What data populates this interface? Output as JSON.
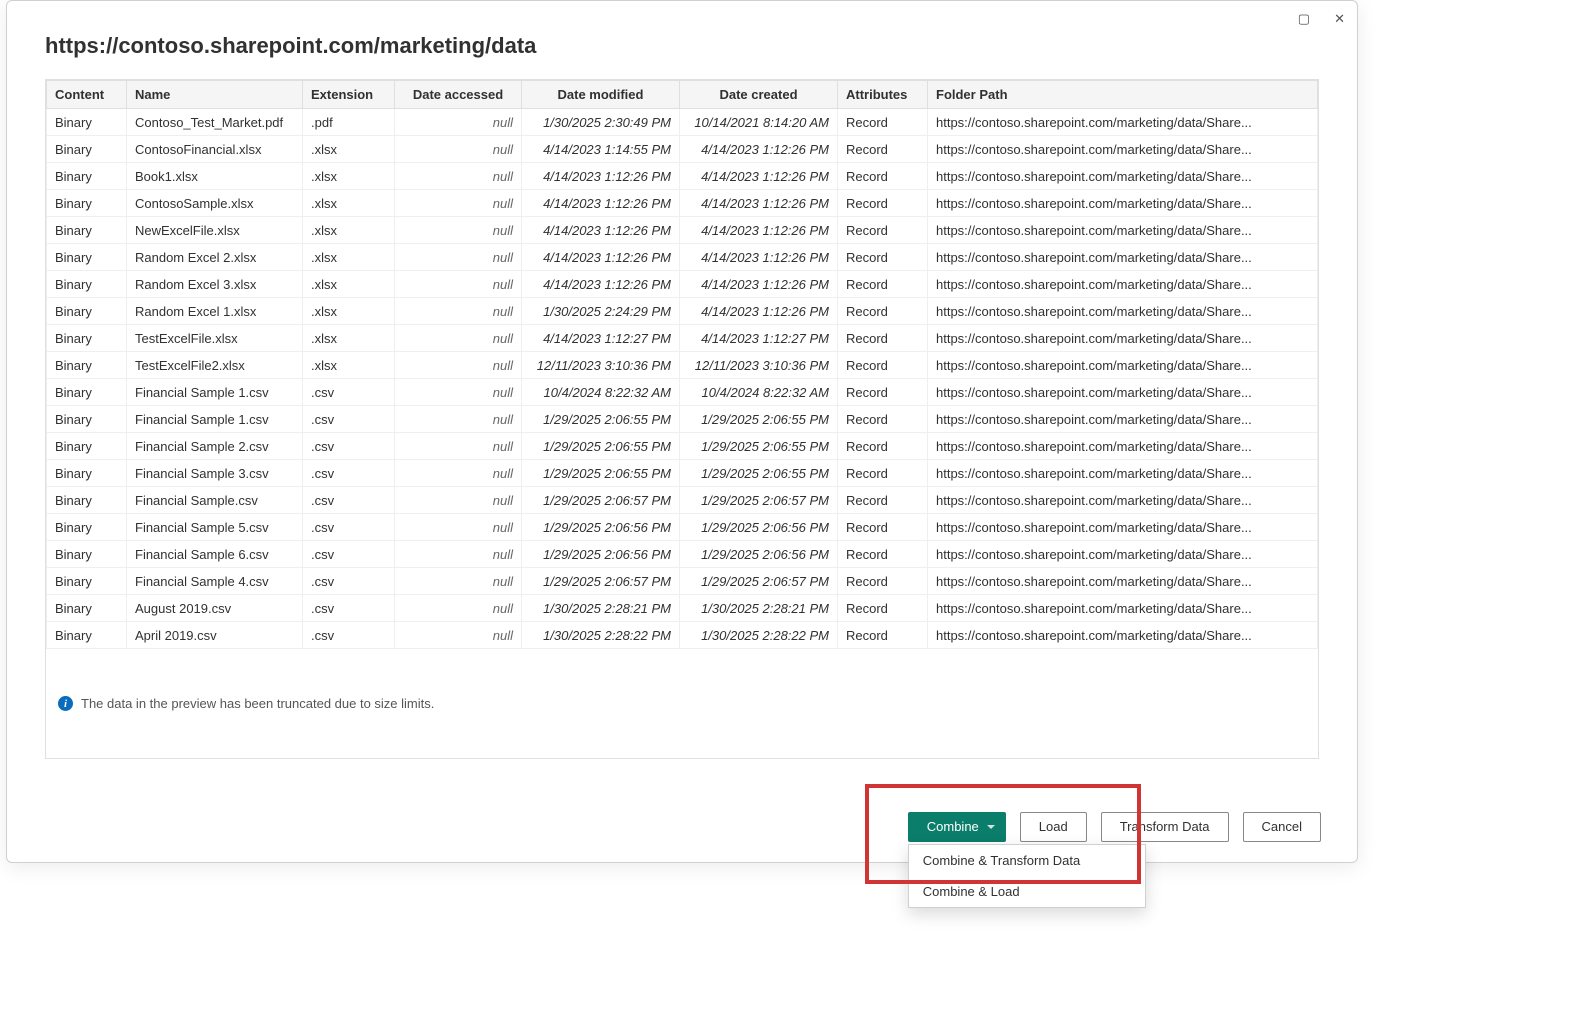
{
  "title": "https://contoso.sharepoint.com/marketing/data",
  "columns": [
    "Content",
    "Name",
    "Extension",
    "Date accessed",
    "Date modified",
    "Date created",
    "Attributes",
    "Folder Path"
  ],
  "null_label": "null",
  "rows": [
    {
      "content": "Binary",
      "name": "Contoso_Test_Market.pdf",
      "ext": ".pdf",
      "acc": "null",
      "mod": "1/30/2025 2:30:49 PM",
      "cre": "10/14/2021 8:14:20 AM",
      "attr": "Record",
      "path": "https://contoso.sharepoint.com/marketing/data/Share..."
    },
    {
      "content": "Binary",
      "name": "ContosoFinancial.xlsx",
      "ext": ".xlsx",
      "acc": "null",
      "mod": "4/14/2023 1:14:55 PM",
      "cre": "4/14/2023 1:12:26 PM",
      "attr": "Record",
      "path": "https://contoso.sharepoint.com/marketing/data/Share..."
    },
    {
      "content": "Binary",
      "name": "Book1.xlsx",
      "ext": ".xlsx",
      "acc": "null",
      "mod": "4/14/2023 1:12:26 PM",
      "cre": "4/14/2023 1:12:26 PM",
      "attr": "Record",
      "path": "https://contoso.sharepoint.com/marketing/data/Share..."
    },
    {
      "content": "Binary",
      "name": "ContosoSample.xlsx",
      "ext": ".xlsx",
      "acc": "null",
      "mod": "4/14/2023 1:12:26 PM",
      "cre": "4/14/2023 1:12:26 PM",
      "attr": "Record",
      "path": "https://contoso.sharepoint.com/marketing/data/Share..."
    },
    {
      "content": "Binary",
      "name": "NewExcelFile.xlsx",
      "ext": ".xlsx",
      "acc": "null",
      "mod": "4/14/2023 1:12:26 PM",
      "cre": "4/14/2023 1:12:26 PM",
      "attr": "Record",
      "path": "https://contoso.sharepoint.com/marketing/data/Share..."
    },
    {
      "content": "Binary",
      "name": "Random Excel 2.xlsx",
      "ext": ".xlsx",
      "acc": "null",
      "mod": "4/14/2023 1:12:26 PM",
      "cre": "4/14/2023 1:12:26 PM",
      "attr": "Record",
      "path": "https://contoso.sharepoint.com/marketing/data/Share..."
    },
    {
      "content": "Binary",
      "name": "Random Excel 3.xlsx",
      "ext": ".xlsx",
      "acc": "null",
      "mod": "4/14/2023 1:12:26 PM",
      "cre": "4/14/2023 1:12:26 PM",
      "attr": "Record",
      "path": "https://contoso.sharepoint.com/marketing/data/Share..."
    },
    {
      "content": "Binary",
      "name": "Random Excel 1.xlsx",
      "ext": ".xlsx",
      "acc": "null",
      "mod": "1/30/2025 2:24:29 PM",
      "cre": "4/14/2023 1:12:26 PM",
      "attr": "Record",
      "path": "https://contoso.sharepoint.com/marketing/data/Share..."
    },
    {
      "content": "Binary",
      "name": "TestExcelFile.xlsx",
      "ext": ".xlsx",
      "acc": "null",
      "mod": "4/14/2023 1:12:27 PM",
      "cre": "4/14/2023 1:12:27 PM",
      "attr": "Record",
      "path": "https://contoso.sharepoint.com/marketing/data/Share..."
    },
    {
      "content": "Binary",
      "name": "TestExcelFile2.xlsx",
      "ext": ".xlsx",
      "acc": "null",
      "mod": "12/11/2023 3:10:36 PM",
      "cre": "12/11/2023 3:10:36 PM",
      "attr": "Record",
      "path": "https://contoso.sharepoint.com/marketing/data/Share..."
    },
    {
      "content": "Binary",
      "name": "Financial Sample 1.csv",
      "ext": ".csv",
      "acc": "null",
      "mod": "10/4/2024 8:22:32 AM",
      "cre": "10/4/2024 8:22:32 AM",
      "attr": "Record",
      "path": "https://contoso.sharepoint.com/marketing/data/Share..."
    },
    {
      "content": "Binary",
      "name": "Financial Sample 1.csv",
      "ext": ".csv",
      "acc": "null",
      "mod": "1/29/2025 2:06:55 PM",
      "cre": "1/29/2025 2:06:55 PM",
      "attr": "Record",
      "path": "https://contoso.sharepoint.com/marketing/data/Share..."
    },
    {
      "content": "Binary",
      "name": "Financial Sample 2.csv",
      "ext": ".csv",
      "acc": "null",
      "mod": "1/29/2025 2:06:55 PM",
      "cre": "1/29/2025 2:06:55 PM",
      "attr": "Record",
      "path": "https://contoso.sharepoint.com/marketing/data/Share..."
    },
    {
      "content": "Binary",
      "name": "Financial Sample 3.csv",
      "ext": ".csv",
      "acc": "null",
      "mod": "1/29/2025 2:06:55 PM",
      "cre": "1/29/2025 2:06:55 PM",
      "attr": "Record",
      "path": "https://contoso.sharepoint.com/marketing/data/Share..."
    },
    {
      "content": "Binary",
      "name": "Financial Sample.csv",
      "ext": ".csv",
      "acc": "null",
      "mod": "1/29/2025 2:06:57 PM",
      "cre": "1/29/2025 2:06:57 PM",
      "attr": "Record",
      "path": "https://contoso.sharepoint.com/marketing/data/Share..."
    },
    {
      "content": "Binary",
      "name": "Financial Sample 5.csv",
      "ext": ".csv",
      "acc": "null",
      "mod": "1/29/2025 2:06:56 PM",
      "cre": "1/29/2025 2:06:56 PM",
      "attr": "Record",
      "path": "https://contoso.sharepoint.com/marketing/data/Share..."
    },
    {
      "content": "Binary",
      "name": "Financial Sample 6.csv",
      "ext": ".csv",
      "acc": "null",
      "mod": "1/29/2025 2:06:56 PM",
      "cre": "1/29/2025 2:06:56 PM",
      "attr": "Record",
      "path": "https://contoso.sharepoint.com/marketing/data/Share..."
    },
    {
      "content": "Binary",
      "name": "Financial Sample 4.csv",
      "ext": ".csv",
      "acc": "null",
      "mod": "1/29/2025 2:06:57 PM",
      "cre": "1/29/2025 2:06:57 PM",
      "attr": "Record",
      "path": "https://contoso.sharepoint.com/marketing/data/Share..."
    },
    {
      "content": "Binary",
      "name": "August 2019.csv",
      "ext": ".csv",
      "acc": "null",
      "mod": "1/30/2025 2:28:21 PM",
      "cre": "1/30/2025 2:28:21 PM",
      "attr": "Record",
      "path": "https://contoso.sharepoint.com/marketing/data/Share..."
    },
    {
      "content": "Binary",
      "name": "April 2019.csv",
      "ext": ".csv",
      "acc": "null",
      "mod": "1/30/2025 2:28:22 PM",
      "cre": "1/30/2025 2:28:22 PM",
      "attr": "Record",
      "path": "https://contoso.sharepoint.com/marketing/data/Share..."
    }
  ],
  "info_message": "The data in the preview has been truncated due to size limits.",
  "buttons": {
    "combine": "Combine",
    "load": "Load",
    "transform": "Transform Data",
    "cancel": "Cancel"
  },
  "dropdown": {
    "combine_transform": "Combine & Transform Data",
    "combine_load": "Combine & Load"
  }
}
